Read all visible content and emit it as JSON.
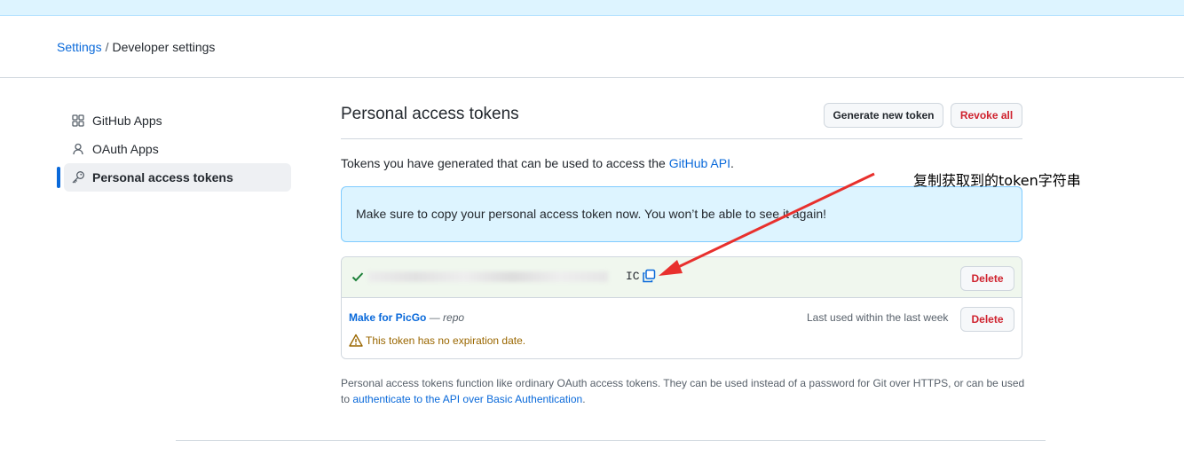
{
  "breadcrumb": {
    "root": "Settings",
    "separator": "/",
    "current": "Developer settings"
  },
  "sidebar": {
    "items": [
      {
        "label": "GitHub Apps",
        "icon": "apps-icon"
      },
      {
        "label": "OAuth Apps",
        "icon": "person-icon"
      },
      {
        "label": "Personal access tokens",
        "icon": "key-icon",
        "active": true
      }
    ]
  },
  "main": {
    "title": "Personal access tokens",
    "generate_label": "Generate new token",
    "revoke_label": "Revoke all",
    "intro_text": "Tokens you have generated that can be used to access the ",
    "intro_link": "GitHub API",
    "intro_end": ".",
    "flash_text": "Make sure to copy your personal access token now. You won’t be able to see it again!",
    "new_token": {
      "visible_suffix": "IC",
      "delete_label": "Delete"
    },
    "existing_token": {
      "name": "Make for PicGo",
      "dash": " — ",
      "scope": "repo",
      "last_used": "Last used within the last week",
      "delete_label": "Delete",
      "warning": "This token has no expiration date."
    },
    "footnote_text": "Personal access tokens function like ordinary OAuth access tokens. They can be used instead of a password for Git over HTTPS, or can be used to ",
    "footnote_link": "authenticate to the API over Basic Authentication",
    "footnote_end": "."
  },
  "annotation": {
    "text": "复制获取到的token字符串",
    "arrow_color": "#e8302d"
  },
  "colors": {
    "link": "#0969da",
    "danger": "#cf222e",
    "flash_bg": "#ddf4ff",
    "success_bg": "#f0f7ee",
    "warning": "#9a6700"
  }
}
